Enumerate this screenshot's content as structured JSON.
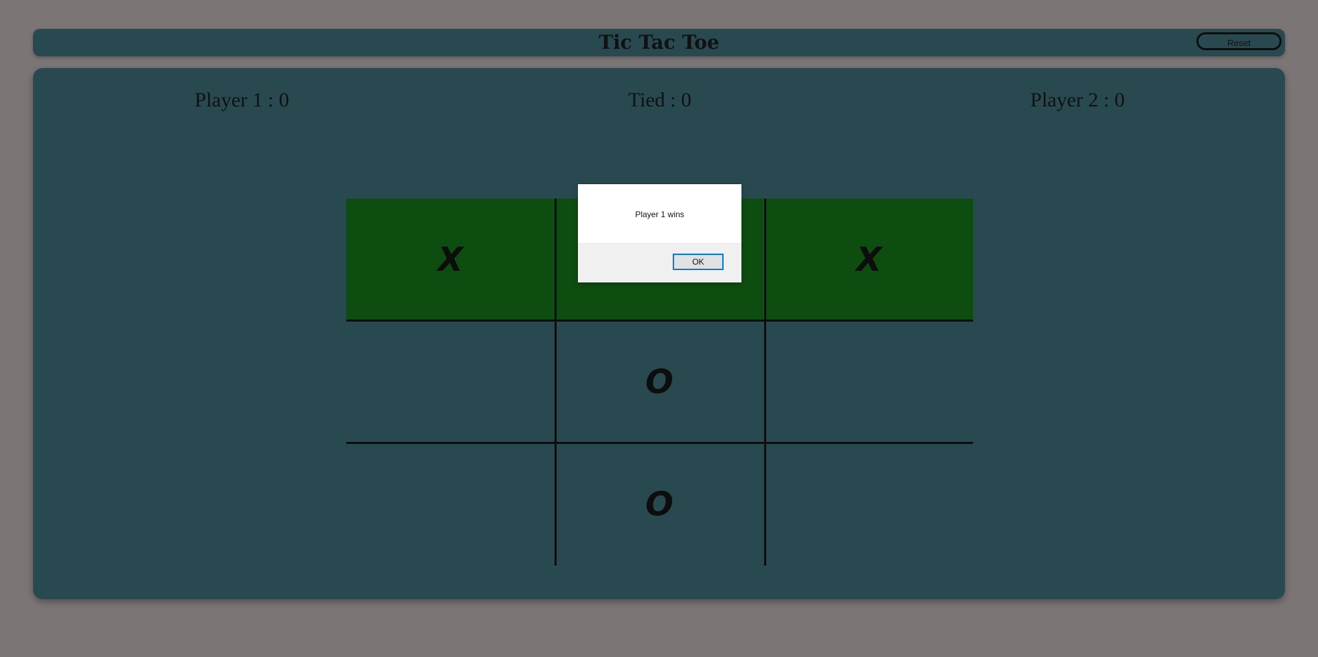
{
  "header": {
    "title": "Tic Tac Toe",
    "reset_label": "Reset"
  },
  "scores": {
    "player1": "Player 1 : 0",
    "tied": "Tied : 0",
    "player2": "Player 2 : 0"
  },
  "board": {
    "cells": [
      [
        "X",
        "",
        "X"
      ],
      [
        "",
        "O",
        ""
      ],
      [
        "",
        "O",
        ""
      ]
    ],
    "winning_row": 0,
    "win_color": "#0d4d10",
    "board_color": "#294950"
  },
  "dialog": {
    "message": "Player 1 wins",
    "ok_label": "OK"
  }
}
